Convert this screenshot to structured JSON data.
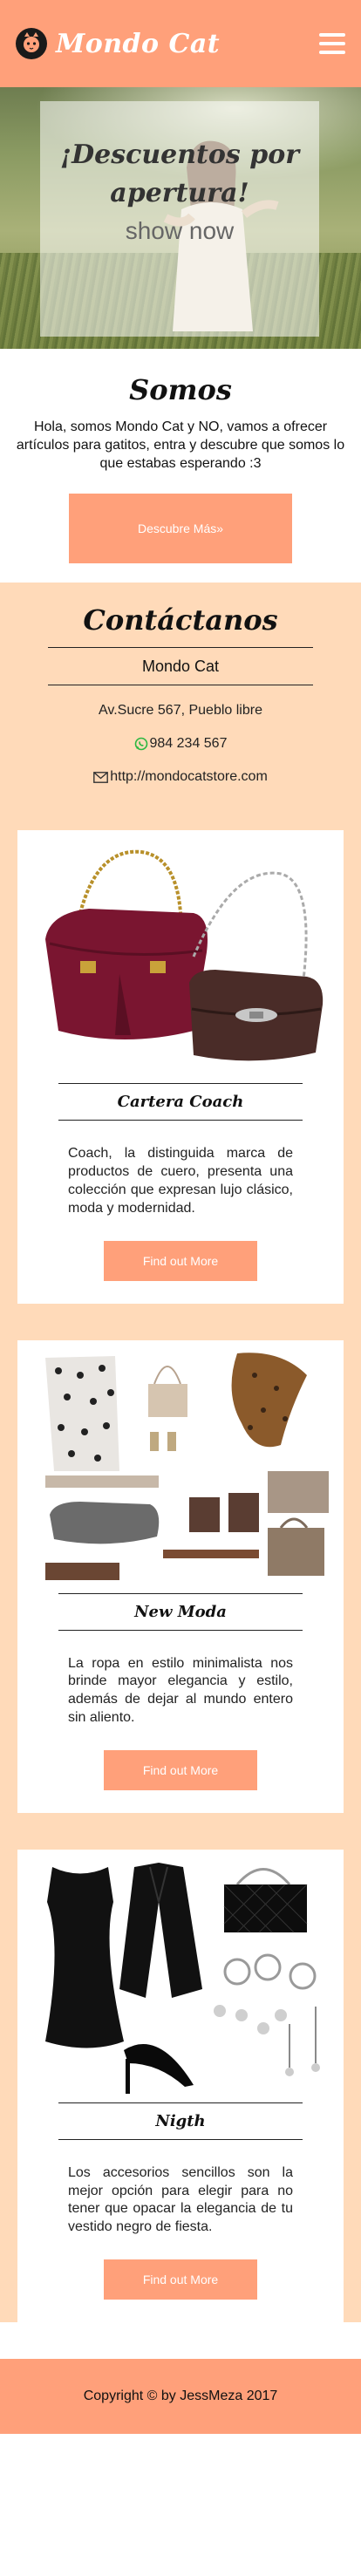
{
  "header": {
    "brand": "Mondo Cat",
    "logo_icon": "cat-logo-icon",
    "menu_icon": "hamburger-menu-icon"
  },
  "hero": {
    "title": "¡Descuentos por apertura!",
    "cta": "show now"
  },
  "about": {
    "heading": "Somos",
    "text": "Hola, somos Mondo Cat y NO, vamos a ofrecer artículos para gatitos, entra y descubre que somos lo que estabas esperando :3",
    "button": "Descubre Más»"
  },
  "contact": {
    "heading": "Contáctanos",
    "name": "Mondo Cat",
    "address": "Av.Sucre 567, Pueblo libre",
    "phone": "984 234 567",
    "website": "http://mondocatstore.com",
    "phone_icon": "whatsapp-icon",
    "web_icon": "envelope-icon"
  },
  "products": [
    {
      "title": "Cartera Coach",
      "text": "Coach, la distinguida marca de productos de cuero, presenta una colección que expresan lujo clásico, moda y modernidad.",
      "button": "Find out More"
    },
    {
      "title": "New Moda",
      "text": "La ropa en estilo minimalista nos brinde mayor elegancia y estilo, además de dejar al mundo entero sin aliento.",
      "button": "Find out More"
    },
    {
      "title": "Nigth",
      "text": "Los accesorios sencillos son la mejor opción para elegir para no tener que opacar la elegancia de tu vestido negro de fiesta.",
      "button": "Find out More"
    }
  ],
  "footer": {
    "copyright": "Copyright © by JessMeza 2017"
  },
  "colors": {
    "primary": "#FFA07A",
    "secondary": "#FFDAB9"
  }
}
